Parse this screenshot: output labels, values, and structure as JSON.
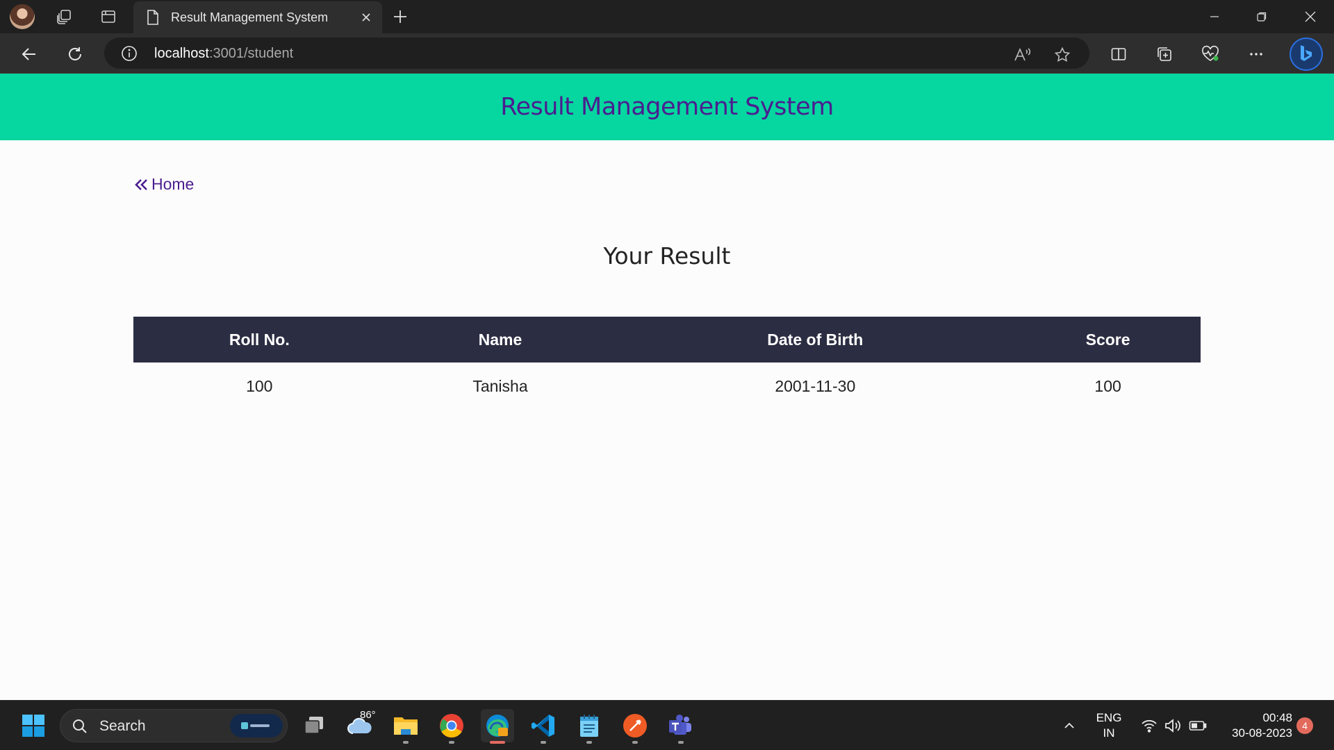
{
  "browser": {
    "tab_title": "Result Management System",
    "url_host": "localhost",
    "url_path": ":3001/student"
  },
  "page": {
    "header_title": "Result Management System",
    "home_link": "Home",
    "result_heading": "Your Result",
    "table": {
      "columns": [
        "Roll No.",
        "Name",
        "Date of Birth",
        "Score"
      ],
      "rows": [
        [
          "100",
          "Tanisha",
          "2001-11-30",
          "100"
        ]
      ]
    }
  },
  "taskbar": {
    "search_placeholder": "Search",
    "weather_temp": "86°",
    "language_line1": "ENG",
    "language_line2": "IN",
    "time": "00:48",
    "date": "30-08-2023",
    "notification_count": "4"
  },
  "colors": {
    "header_bg": "#06d6a0",
    "header_text": "#4b1d8f",
    "table_header_bg": "#2b2d42"
  }
}
